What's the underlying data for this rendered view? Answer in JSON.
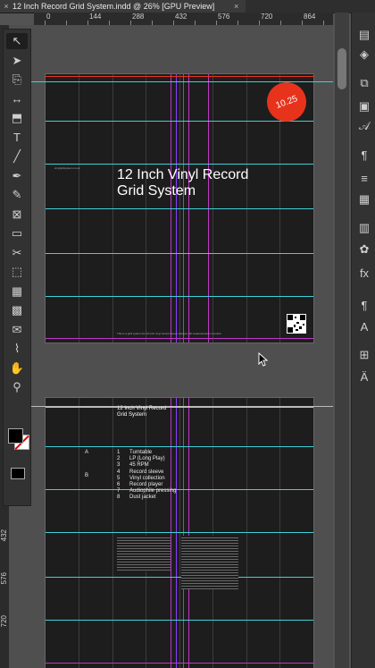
{
  "window": {
    "tab_title": "12 Inch Record Grid System.indd @ 26% [GPU Preview]",
    "close_glyph": "×"
  },
  "ruler": {
    "h_ticks": [
      "0",
      "144",
      "288",
      "432",
      "576",
      "720",
      "864"
    ],
    "v_ticks": [
      "432",
      "576",
      "720"
    ]
  },
  "toolbar": {
    "tools": [
      {
        "name": "selection-tool",
        "glyph": "↖"
      },
      {
        "name": "direct-selection-tool",
        "glyph": "➤"
      },
      {
        "name": "page-tool",
        "glyph": "⎘"
      },
      {
        "name": "gap-tool",
        "glyph": "↔"
      },
      {
        "name": "content-collector-tool",
        "glyph": "⬒"
      },
      {
        "name": "type-tool",
        "glyph": "T"
      },
      {
        "name": "line-tool",
        "glyph": "╱"
      },
      {
        "name": "pen-tool",
        "glyph": "✒"
      },
      {
        "name": "pencil-tool",
        "glyph": "✎"
      },
      {
        "name": "rectangle-frame-tool",
        "glyph": "⊠"
      },
      {
        "name": "rectangle-tool",
        "glyph": "▭"
      },
      {
        "name": "scissors-tool",
        "glyph": "✂"
      },
      {
        "name": "free-transform-tool",
        "glyph": "⬚"
      },
      {
        "name": "gradient-swatch-tool",
        "glyph": "▦"
      },
      {
        "name": "gradient-feather-tool",
        "glyph": "▩"
      },
      {
        "name": "note-tool",
        "glyph": "✉"
      },
      {
        "name": "eyedropper-tool",
        "glyph": "⌇"
      },
      {
        "name": "hand-tool",
        "glyph": "✋"
      },
      {
        "name": "zoom-tool",
        "glyph": "⚲"
      }
    ]
  },
  "page1": {
    "title_line1": "12 Inch Vinyl Record",
    "title_line2": "Grid System",
    "badge": "10.25",
    "small_label": "vinylgridsystem.co.uk",
    "footer": "This is a grid system for 12 inch vinyl record sleeve designs. All measurements in points."
  },
  "page2": {
    "title_line1": "12 Inch Vinyl Record",
    "title_line2": "Grid System",
    "section_a": "A",
    "section_b": "B",
    "toc": [
      {
        "num": "1",
        "label": "Turntable"
      },
      {
        "num": "2",
        "label": "LP (Long Play)"
      },
      {
        "num": "3",
        "label": "45 RPM"
      },
      {
        "num": "4",
        "label": "Record sleeve"
      },
      {
        "num": "5",
        "label": "Vinyl collection"
      },
      {
        "num": "6",
        "label": "Record player"
      },
      {
        "num": "7",
        "label": "Audiophile pressing"
      },
      {
        "num": "8",
        "label": "Dust jacket"
      }
    ]
  },
  "colors": {
    "guide_cyan": "#3fd0d8",
    "guide_magenta": "#c236c8",
    "guide_purple": "#8a3cff",
    "badge_red": "#e8331c"
  },
  "right_panel": {
    "icons": [
      "pages-icon",
      "layers-icon",
      "links-icon",
      "library-icon",
      "character-styles-icon",
      "paragraph-styles-icon",
      "stroke-icon",
      "swatches-icon",
      "text-wrap-icon",
      "color-icon",
      "effects-icon",
      "paragraph-icon",
      "character-icon",
      "align-icon",
      "glyphs-icon"
    ]
  }
}
